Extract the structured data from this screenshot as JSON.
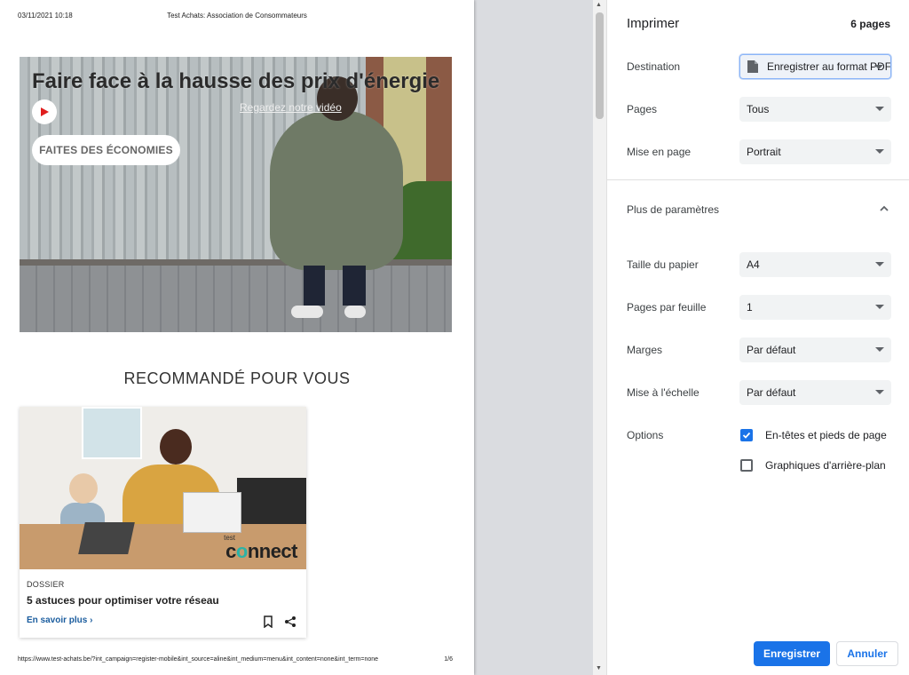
{
  "page": {
    "header_date": "03/11/2021 10:18",
    "header_title": "Test Achats: Association de Consommateurs",
    "footer_url": "https://www.test-achats.be/?int_campaign=register-mobile&int_source=aline&int_medium=menu&int_content=none&int_term=none",
    "footer_page": "1/6",
    "hero": {
      "title": "Faire face à la hausse des prix d'énergie",
      "video_link": "Regardez notre vidéo",
      "cta": "FAITES DES ÉCONOMIES"
    },
    "reco_title": "RECOMMANDÉ POUR VOUS",
    "card": {
      "logo_small": "test",
      "logo_main_1": "c",
      "logo_main_o": "o",
      "logo_main_2": "nnect",
      "category": "DOSSIER",
      "title": "5 astuces pour optimiser votre réseau",
      "link": "En savoir plus ›"
    }
  },
  "panel": {
    "title": "Imprimer",
    "pages_count": "6 pages",
    "destination": {
      "label": "Destination",
      "value": "Enregistrer au format PDF"
    },
    "pages": {
      "label": "Pages",
      "value": "Tous"
    },
    "layout": {
      "label": "Mise en page",
      "value": "Portrait"
    },
    "more_params": "Plus de paramètres",
    "paper_size": {
      "label": "Taille du papier",
      "value": "A4"
    },
    "pages_per_sheet": {
      "label": "Pages par feuille",
      "value": "1"
    },
    "margins": {
      "label": "Marges",
      "value": "Par défaut"
    },
    "scale": {
      "label": "Mise à l'échelle",
      "value": "Par défaut"
    },
    "options": {
      "label": "Options",
      "headers_footers": {
        "label": "En-têtes et pieds de page",
        "checked": true
      },
      "background_graphics": {
        "label": "Graphiques d'arrière-plan",
        "checked": false
      }
    },
    "save_button": "Enregistrer",
    "cancel_button": "Annuler"
  },
  "colors": {
    "accent": "#1a73e8",
    "play_red": "#e01e1e",
    "link_blue": "#1a5c9e"
  }
}
